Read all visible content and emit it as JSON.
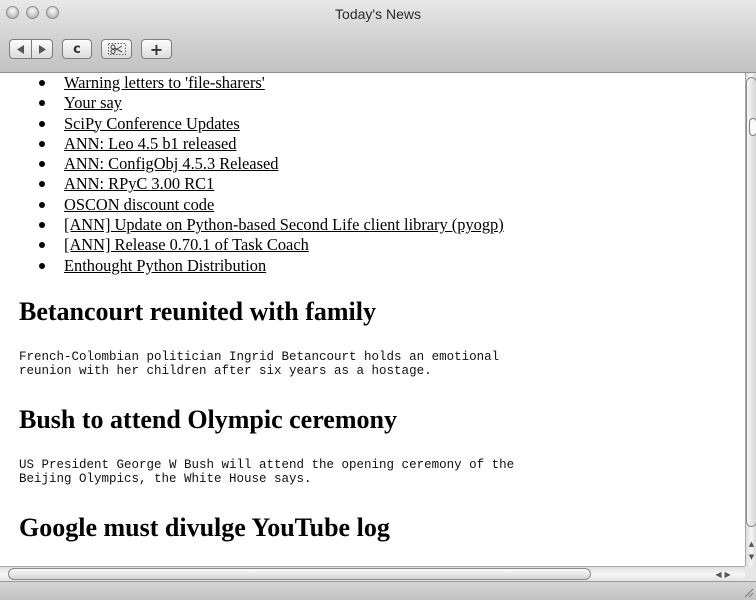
{
  "window": {
    "title": "Today's News"
  },
  "toolbar": {
    "back_icon": "back-arrow-icon",
    "forward_icon": "forward-arrow-icon",
    "reload_label": "c",
    "scissors_icon": "scissors-icon",
    "add_label": "+"
  },
  "links": [
    "Warning letters to 'file-sharers'",
    "Your say",
    "SciPy Conference Updates",
    "ANN: Leo 4.5 b1 released",
    "ANN: ConfigObj 4.5.3 Released",
    "ANN: RPyC 3.00 RC1",
    "OSCON discount code",
    "[ANN] Update on Python-based Second Life client library (pyogp)",
    "[ANN] Release 0.70.1 of Task Coach",
    "Enthought Python Distribution"
  ],
  "stories": [
    {
      "headline": "Betancourt reunited with family",
      "summary": "French-Colombian politician Ingrid Betancourt holds an emotional\nreunion with her children after six years as a hostage."
    },
    {
      "headline": "Bush to attend Olympic ceremony",
      "summary": "US President George W Bush will attend the opening ceremony of the\nBeijing Olympics, the White House says."
    },
    {
      "headline": "Google must divulge YouTube log"
    }
  ]
}
